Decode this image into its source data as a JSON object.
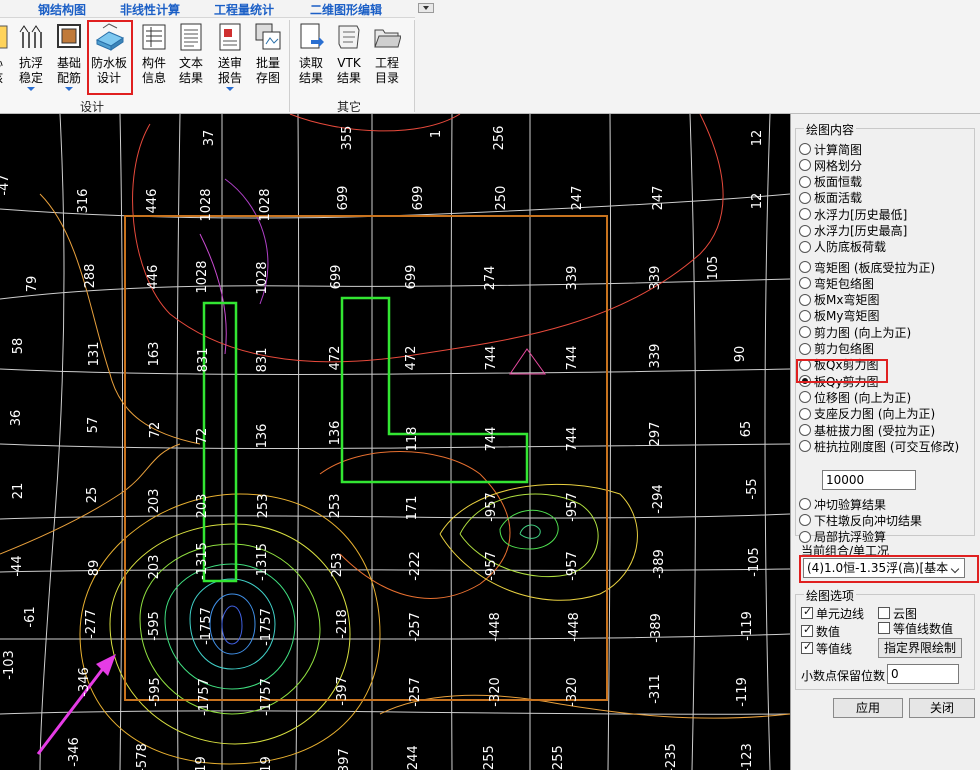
{
  "ribbon": {
    "tabs": [
      {
        "label": "钢结构图"
      },
      {
        "label": "非线性计算"
      },
      {
        "label": "工程量统计"
      },
      {
        "label": "二维图形编辑"
      }
    ],
    "buttons": [
      {
        "l1": "心",
        "l2": "核",
        "icon": "partial-icon"
      },
      {
        "l1": "抗浮",
        "l2": "稳定",
        "icon": "anti-float-icon",
        "dropdown": true
      },
      {
        "l1": "基础",
        "l2": "配筋",
        "icon": "foundation-rebar-icon",
        "dropdown": true
      },
      {
        "l1": "防水板",
        "l2": "设计",
        "icon": "waterproof-slab-icon"
      },
      {
        "l1": "构件",
        "l2": "信息",
        "icon": "member-info-icon"
      },
      {
        "l1": "文本",
        "l2": "结果",
        "icon": "text-result-icon"
      },
      {
        "l1": "送审",
        "l2": "报告",
        "icon": "review-report-icon",
        "dropdown": true
      },
      {
        "l1": "批量",
        "l2": "存图",
        "icon": "batch-save-icon"
      },
      {
        "l1": "读取",
        "l2": "结果",
        "icon": "read-result-icon"
      },
      {
        "l1": "VTK",
        "l2": "结果",
        "icon": "vtk-icon"
      },
      {
        "l1": "工程",
        "l2": "目录",
        "icon": "folder-icon"
      }
    ],
    "groups": {
      "design": "设计",
      "other": "其它"
    }
  },
  "panel": {
    "title": "绘图内容",
    "radios_a": [
      "计算简图",
      "网格划分",
      "板面恒载",
      "板面活载",
      "水浮力[历史最低]",
      "水浮力[历史最高]",
      "人防底板荷载"
    ],
    "radios_b": [
      "弯矩图 (板底受拉为正)",
      "弯矩包络图",
      "板Mx弯矩图",
      "板My弯矩图",
      "剪力图 (向上为正)",
      "剪力包络图",
      "板Qx剪力图",
      "板Qy剪力图",
      "位移图 (向上为正)",
      "支座反力图 (向上为正)",
      "基桩拔力图 (受拉为正)",
      "桩抗拉刚度图 (可交互修改)"
    ],
    "selected": "板Qy剪力图",
    "stiffness_value": "10000",
    "radios_c": [
      "冲切验算结果",
      "下柱墩反向冲切结果",
      "局部抗浮验算"
    ],
    "combo_title": "当前组合/单工况",
    "combo_value": "(4)1.0恒-1.35浮(高)[基本",
    "options_title": "绘图选项",
    "checks": [
      {
        "label": "单元边线",
        "on": true
      },
      {
        "label": "云图",
        "on": false
      },
      {
        "label": "数值",
        "on": true
      },
      {
        "label": "等值线数值",
        "on": false
      },
      {
        "label": "等值线",
        "on": true
      }
    ],
    "boundary_button": "指定界限绘制",
    "decimal_label": "小数点保留位数",
    "decimal_value": "0",
    "apply": "应用",
    "close": "关闭"
  },
  "colors": {
    "outline": "#c8731e",
    "column": "#33e633",
    "grid": "#d9d9d9",
    "arrow": "#e63ce6",
    "highlight": "#e02020"
  },
  "canvas": {
    "labels": [
      [
        "37",
        205,
        4
      ],
      [
        "355",
        343,
        4
      ],
      [
        "256",
        495,
        4
      ],
      [
        "12",
        753,
        4
      ],
      [
        "1",
        432,
        0
      ],
      [
        "-47",
        0,
        51
      ],
      [
        "316",
        79,
        67
      ],
      [
        "446",
        148,
        67
      ],
      [
        "1028",
        202,
        71
      ],
      [
        "1028",
        261,
        71
      ],
      [
        "699",
        339,
        64
      ],
      [
        "699",
        414,
        64
      ],
      [
        "250",
        497,
        64
      ],
      [
        "247",
        573,
        64
      ],
      [
        "247",
        654,
        64
      ],
      [
        "12",
        753,
        67
      ],
      [
        "79",
        28,
        150
      ],
      [
        "288",
        86,
        142
      ],
      [
        "446",
        149,
        143
      ],
      [
        "1028",
        198,
        143
      ],
      [
        "1028",
        258,
        144
      ],
      [
        "699",
        332,
        143
      ],
      [
        "699",
        407,
        143
      ],
      [
        "274",
        486,
        144
      ],
      [
        "339",
        568,
        144
      ],
      [
        "339",
        651,
        144
      ],
      [
        "105",
        709,
        134
      ],
      [
        "58",
        14,
        212
      ],
      [
        "131",
        90,
        220
      ],
      [
        "163",
        150,
        220
      ],
      [
        "831",
        199,
        226
      ],
      [
        "831",
        258,
        226
      ],
      [
        "472",
        331,
        224
      ],
      [
        "472",
        407,
        224
      ],
      [
        "744",
        487,
        224
      ],
      [
        "744",
        568,
        224
      ],
      [
        "339",
        651,
        222
      ],
      [
        "90",
        736,
        220
      ],
      [
        "36",
        12,
        284
      ],
      [
        "57",
        89,
        291
      ],
      [
        "72",
        151,
        296
      ],
      [
        "72",
        198,
        302
      ],
      [
        "136",
        258,
        302
      ],
      [
        "136",
        331,
        299
      ],
      [
        "118",
        408,
        305
      ],
      [
        "744",
        487,
        305
      ],
      [
        "744",
        568,
        305
      ],
      [
        "297",
        651,
        300
      ],
      [
        "65",
        742,
        295
      ],
      [
        "21",
        14,
        357
      ],
      [
        "25",
        88,
        361
      ],
      [
        "203",
        150,
        367
      ],
      [
        "203",
        198,
        372
      ],
      [
        "253",
        259,
        372
      ],
      [
        "253",
        331,
        372
      ],
      [
        "171",
        408,
        374
      ],
      [
        "-957",
        487,
        373
      ],
      [
        "-957",
        568,
        373
      ],
      [
        "-294",
        654,
        365
      ],
      [
        "-55",
        748,
        355
      ],
      [
        "-44",
        13,
        432
      ],
      [
        "89",
        90,
        434
      ],
      [
        "203",
        150,
        433
      ],
      [
        "-1315",
        198,
        427
      ],
      [
        "-1315",
        258,
        428
      ],
      [
        "253",
        333,
        431
      ],
      [
        "-222",
        411,
        432
      ],
      [
        "-957",
        487,
        432
      ],
      [
        "-957",
        568,
        432
      ],
      [
        "-389",
        655,
        430
      ],
      [
        "-105",
        750,
        428
      ],
      [
        "-61",
        26,
        483
      ],
      [
        "-277",
        87,
        490
      ],
      [
        "-595",
        150,
        492
      ],
      [
        "-1757",
        202,
        492
      ],
      [
        "-1757",
        262,
        493
      ],
      [
        "-218",
        338,
        490
      ],
      [
        "-257",
        411,
        493
      ],
      [
        "-448",
        491,
        493
      ],
      [
        "-448",
        570,
        493
      ],
      [
        "-389",
        652,
        494
      ],
      [
        "-119",
        743,
        492
      ],
      [
        "-103",
        5,
        531
      ],
      [
        "-346",
        80,
        548
      ],
      [
        "-595",
        151,
        558
      ],
      [
        "-1757",
        200,
        563
      ],
      [
        "-1757",
        262,
        563
      ],
      [
        "-397",
        338,
        557
      ],
      [
        "-257",
        411,
        558
      ],
      [
        "-320",
        491,
        558
      ],
      [
        "-320",
        568,
        558
      ],
      [
        "-311",
        651,
        555
      ],
      [
        "-119",
        738,
        558
      ],
      [
        "-346",
        70,
        618
      ],
      [
        "-578",
        138,
        624
      ],
      [
        "-619",
        197,
        637
      ],
      [
        "-619",
        262,
        637
      ],
      [
        "-397",
        340,
        629
      ],
      [
        "-244",
        409,
        626
      ],
      [
        "-255",
        485,
        626
      ],
      [
        "-255",
        554,
        626
      ],
      [
        "-235",
        667,
        624
      ],
      [
        "-123",
        743,
        624
      ],
      [
        "35",
        614,
        650
      ]
    ]
  }
}
